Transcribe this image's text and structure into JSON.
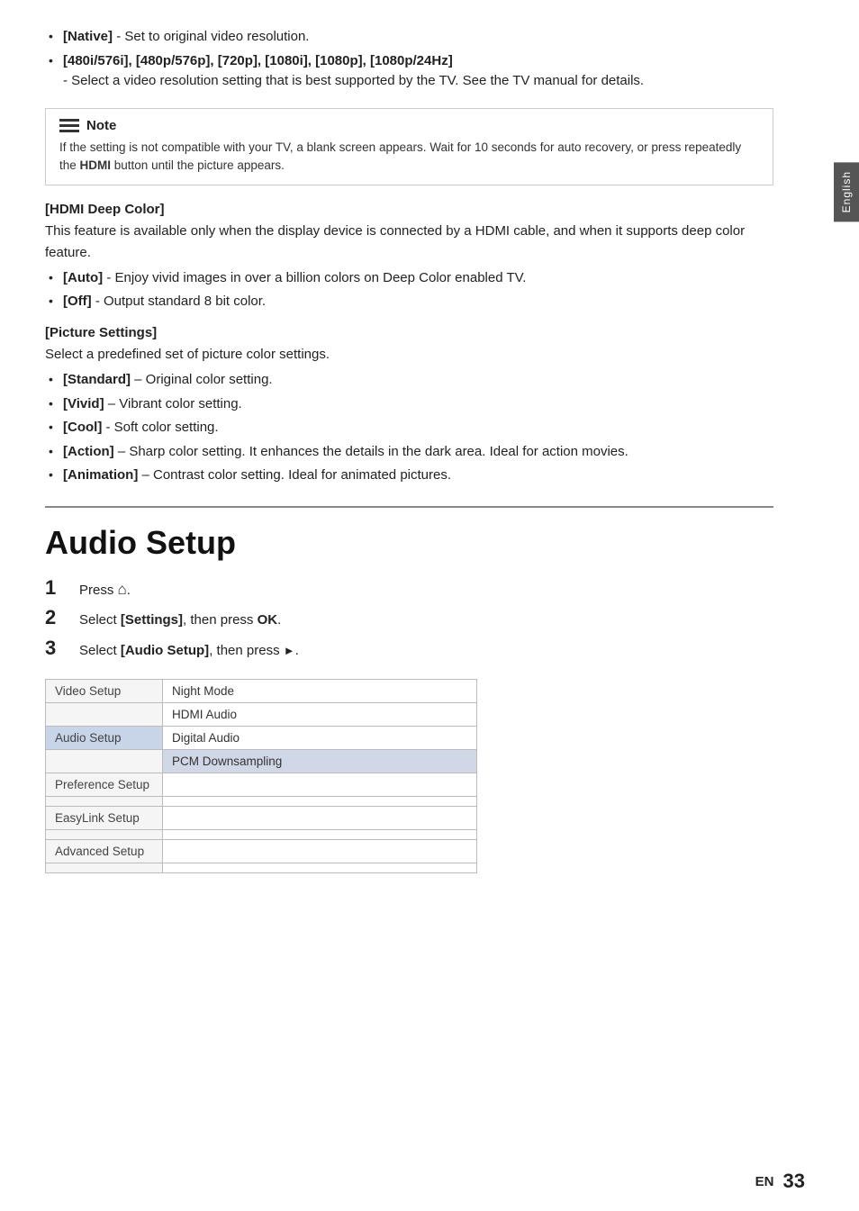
{
  "side_tab": "English",
  "bullets_top": [
    {
      "label": "[Native]",
      "text": " - Set to original video resolution."
    },
    {
      "label": "[480i/576i], [480p/576p], [720p], [1080i], [1080p], [1080p/24Hz]",
      "text": "\n- Select a video resolution setting that is best supported by the TV. See the TV manual for details."
    }
  ],
  "note": {
    "title": "Note",
    "text": "If the setting is not compatible with your TV, a blank screen appears. Wait for 10 seconds for auto recovery, or press repeatedly the HDMI button until the picture appears."
  },
  "hdmi_deep_color": {
    "heading": "[HDMI Deep Color]",
    "intro": "This feature is available only when the display device is connected by a HDMI cable, and when it supports deep color feature.",
    "bullets": [
      {
        "label": "[Auto]",
        "text": " - Enjoy vivid images in over a billion colors on Deep Color enabled TV."
      },
      {
        "label": "[Off]",
        "text": " - Output standard 8 bit color."
      }
    ]
  },
  "picture_settings": {
    "heading": "[Picture Settings]",
    "intro": "Select a predefined set of picture color settings.",
    "bullets": [
      {
        "label": "[Standard]",
        "text": " – Original color setting."
      },
      {
        "label": "[Vivid]",
        "text": " – Vibrant color setting."
      },
      {
        "label": "[Cool]",
        "text": " - Soft color setting."
      },
      {
        "label": "[Action]",
        "text": " – Sharp color setting. It enhances the details in the dark area. Ideal for action movies."
      },
      {
        "label": "[Animation]",
        "text": " – Contrast color setting. Ideal for animated pictures."
      }
    ]
  },
  "audio_setup": {
    "title": "Audio Setup",
    "steps": [
      {
        "num": "1",
        "text": "Press ",
        "icon": "home",
        "after": "."
      },
      {
        "num": "2",
        "text": "Select ",
        "bold": "[Settings]",
        "after": ", then press ",
        "bold2": "OK",
        "end": "."
      },
      {
        "num": "3",
        "text": "Select ",
        "bold": "[Audio Setup]",
        "after": ", then press ",
        "icon": "tri",
        "end": "."
      }
    ],
    "table": {
      "rows": [
        {
          "left": "Video Setup",
          "right": "Night Mode",
          "left_highlight": false,
          "right_highlight": false
        },
        {
          "left": "",
          "right": "HDMI Audio",
          "left_highlight": false,
          "right_highlight": false
        },
        {
          "left": "Audio Setup",
          "right": "Digital Audio",
          "left_highlight": true,
          "right_highlight": false
        },
        {
          "left": "",
          "right": "PCM Downsampling",
          "left_highlight": false,
          "right_highlight": true
        },
        {
          "left": "Preference Setup",
          "right": "",
          "left_highlight": false,
          "right_highlight": false
        },
        {
          "left": "",
          "right": "",
          "left_highlight": false,
          "right_highlight": false
        },
        {
          "left": "EasyLink Setup",
          "right": "",
          "left_highlight": false,
          "right_highlight": false
        },
        {
          "left": "",
          "right": "",
          "left_highlight": false,
          "right_highlight": false
        },
        {
          "left": "Advanced Setup",
          "right": "",
          "left_highlight": false,
          "right_highlight": false
        },
        {
          "left": "",
          "right": "",
          "left_highlight": false,
          "right_highlight": false
        }
      ]
    }
  },
  "footer": {
    "en_label": "EN",
    "page_num": "33"
  }
}
